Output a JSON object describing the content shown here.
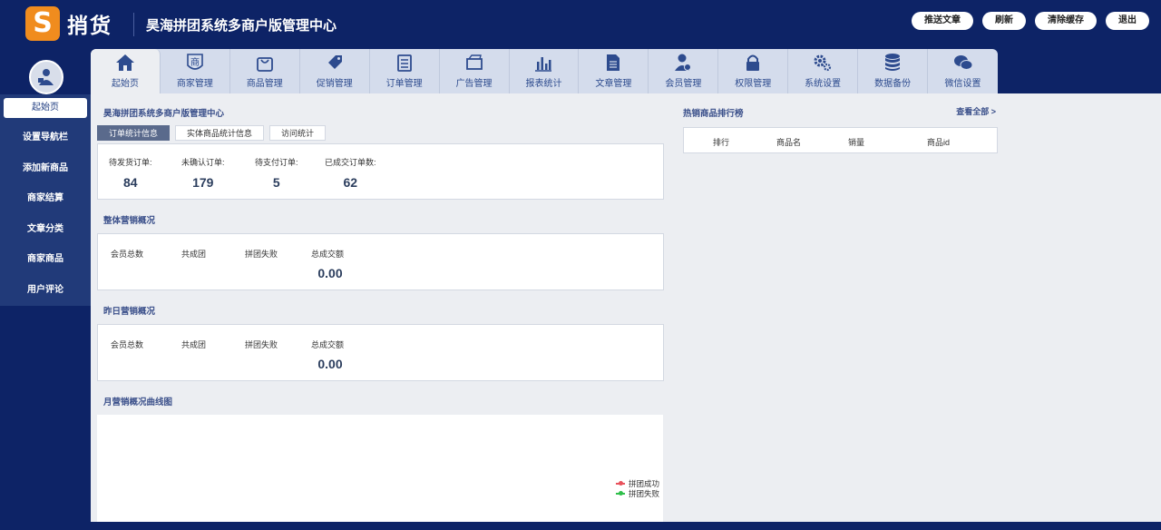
{
  "header": {
    "logo_glyph": "S",
    "logo_text": "捎货",
    "title": "昊海拼团系统多商户版管理中心",
    "actions": [
      "推送文章",
      "刷新",
      "清除缓存",
      "退出"
    ]
  },
  "sidebar": {
    "items": [
      "起始页",
      "设置导航栏",
      "添加新商品",
      "商家结算",
      "文章分类",
      "商家商品",
      "用户评论"
    ]
  },
  "topnav": {
    "items": [
      {
        "label": "起始页",
        "icon": "home-icon"
      },
      {
        "label": "商家管理",
        "icon": "shop-icon"
      },
      {
        "label": "商品管理",
        "icon": "bag-icon"
      },
      {
        "label": "促销管理",
        "icon": "tag-icon"
      },
      {
        "label": "订单管理",
        "icon": "clipboard-icon"
      },
      {
        "label": "广告管理",
        "icon": "card-icon"
      },
      {
        "label": "报表统计",
        "icon": "bar-chart-icon"
      },
      {
        "label": "文章管理",
        "icon": "document-icon"
      },
      {
        "label": "会员管理",
        "icon": "user-icon"
      },
      {
        "label": "权限管理",
        "icon": "lock-icon"
      },
      {
        "label": "系统设置",
        "icon": "gear-icon"
      },
      {
        "label": "数据备份",
        "icon": "database-icon"
      },
      {
        "label": "微信设置",
        "icon": "wechat-icon"
      }
    ]
  },
  "main": {
    "panel_title": "昊海拼团系统多商户版管理中心",
    "tabs": [
      "订单统计信息",
      "实体商品统计信息",
      "访问统计"
    ],
    "order_stats": [
      {
        "label": "待发货订单:",
        "value": "84"
      },
      {
        "label": "未确认订单:",
        "value": "179"
      },
      {
        "label": "待支付订单:",
        "value": "5"
      },
      {
        "label": "已成交订单数:",
        "value": "62"
      }
    ],
    "overall": {
      "title": "整体营销概况",
      "labels": [
        "会员总数",
        "共成团",
        "拼团失败",
        "总成交额"
      ],
      "total_value": "0.00"
    },
    "yesterday": {
      "title": "昨日营销概况",
      "labels": [
        "会员总数",
        "共成团",
        "拼团失败",
        "总成交额"
      ],
      "total_value": "0.00"
    },
    "monthly": {
      "title": "月营销概况曲线图",
      "legend": [
        {
          "name": "拼团成功",
          "color": "#e8525c"
        },
        {
          "name": "拼团失败",
          "color": "#2fbf4a"
        }
      ]
    },
    "ranking": {
      "title": "热销商品排行榜",
      "view_all": "查看全部 >",
      "columns": [
        "排行",
        "商品名",
        "销量",
        "商品id"
      ]
    }
  },
  "colors": {
    "background": "#0d2366",
    "sidebar": "#213a79",
    "logo_accent": "#f08c1e",
    "nav_bar": "#d4dcec",
    "content": "#eceef2"
  }
}
